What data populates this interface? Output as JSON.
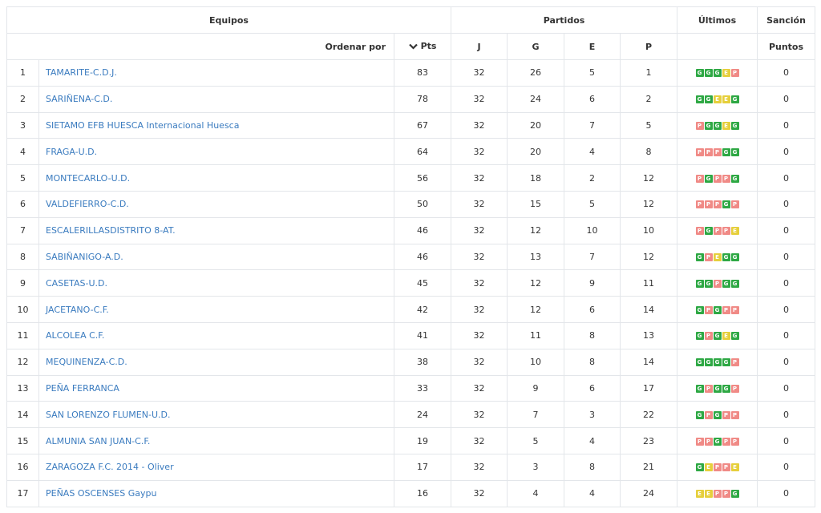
{
  "colors": {
    "win": "#2ea844",
    "draw": "#e6cf3c",
    "loss": "#f08a86",
    "link": "#3a7bbf"
  },
  "header": {
    "equipos": "Equipos",
    "partidos": "Partidos",
    "ultimos": "Últimos",
    "sancion": "Sanción",
    "ordenar_por": "Ordenar por",
    "sort_icon": "chevron-down-icon",
    "pts": "Pts",
    "j": "J",
    "g": "G",
    "e": "E",
    "p": "P",
    "puntos": "Puntos"
  },
  "rows": [
    {
      "pos": "1",
      "team": "TAMARITE-C.D.J.",
      "pts": "83",
      "j": "32",
      "g": "26",
      "e": "5",
      "p": "1",
      "form": [
        "G",
        "G",
        "G",
        "E",
        "P"
      ],
      "sancion": "0"
    },
    {
      "pos": "2",
      "team": "SARIÑENA-C.D.",
      "pts": "78",
      "j": "32",
      "g": "24",
      "e": "6",
      "p": "2",
      "form": [
        "G",
        "G",
        "E",
        "E",
        "G"
      ],
      "sancion": "0"
    },
    {
      "pos": "3",
      "team": "SIETAMO EFB HUESCA Internacional Huesca",
      "pts": "67",
      "j": "32",
      "g": "20",
      "e": "7",
      "p": "5",
      "form": [
        "P",
        "G",
        "G",
        "E",
        "G"
      ],
      "sancion": "0"
    },
    {
      "pos": "4",
      "team": "FRAGA-U.D.",
      "pts": "64",
      "j": "32",
      "g": "20",
      "e": "4",
      "p": "8",
      "form": [
        "P",
        "P",
        "P",
        "G",
        "G"
      ],
      "sancion": "0"
    },
    {
      "pos": "5",
      "team": "MONTECARLO-U.D.",
      "pts": "56",
      "j": "32",
      "g": "18",
      "e": "2",
      "p": "12",
      "form": [
        "P",
        "G",
        "P",
        "P",
        "G"
      ],
      "sancion": "0"
    },
    {
      "pos": "6",
      "team": "VALDEFIERRO-C.D.",
      "pts": "50",
      "j": "32",
      "g": "15",
      "e": "5",
      "p": "12",
      "form": [
        "P",
        "P",
        "P",
        "G",
        "P"
      ],
      "sancion": "0"
    },
    {
      "pos": "7",
      "team": "ESCALERILLASDISTRITO 8-AT.",
      "pts": "46",
      "j": "32",
      "g": "12",
      "e": "10",
      "p": "10",
      "form": [
        "P",
        "G",
        "P",
        "P",
        "E"
      ],
      "sancion": "0"
    },
    {
      "pos": "8",
      "team": "SABIÑANIGO-A.D.",
      "pts": "46",
      "j": "32",
      "g": "13",
      "e": "7",
      "p": "12",
      "form": [
        "G",
        "P",
        "E",
        "G",
        "G"
      ],
      "sancion": "0"
    },
    {
      "pos": "9",
      "team": "CASETAS-U.D.",
      "pts": "45",
      "j": "32",
      "g": "12",
      "e": "9",
      "p": "11",
      "form": [
        "G",
        "G",
        "P",
        "G",
        "G"
      ],
      "sancion": "0"
    },
    {
      "pos": "10",
      "team": "JACETANO-C.F.",
      "pts": "42",
      "j": "32",
      "g": "12",
      "e": "6",
      "p": "14",
      "form": [
        "G",
        "P",
        "G",
        "P",
        "P"
      ],
      "sancion": "0"
    },
    {
      "pos": "11",
      "team": "ALCOLEA C.F.",
      "pts": "41",
      "j": "32",
      "g": "11",
      "e": "8",
      "p": "13",
      "form": [
        "G",
        "P",
        "G",
        "E",
        "G"
      ],
      "sancion": "0"
    },
    {
      "pos": "12",
      "team": "MEQUINENZA-C.D.",
      "pts": "38",
      "j": "32",
      "g": "10",
      "e": "8",
      "p": "14",
      "form": [
        "G",
        "G",
        "G",
        "G",
        "P"
      ],
      "sancion": "0"
    },
    {
      "pos": "13",
      "team": "PEÑA FERRANCA",
      "pts": "33",
      "j": "32",
      "g": "9",
      "e": "6",
      "p": "17",
      "form": [
        "G",
        "P",
        "G",
        "G",
        "P"
      ],
      "sancion": "0"
    },
    {
      "pos": "14",
      "team": "SAN LORENZO FLUMEN-U.D.",
      "pts": "24",
      "j": "32",
      "g": "7",
      "e": "3",
      "p": "22",
      "form": [
        "G",
        "P",
        "G",
        "P",
        "P"
      ],
      "sancion": "0"
    },
    {
      "pos": "15",
      "team": "ALMUNIA SAN JUAN-C.F.",
      "pts": "19",
      "j": "32",
      "g": "5",
      "e": "4",
      "p": "23",
      "form": [
        "P",
        "P",
        "G",
        "P",
        "P"
      ],
      "sancion": "0"
    },
    {
      "pos": "16",
      "team": "ZARAGOZA F.C. 2014 - Oliver",
      "pts": "17",
      "j": "32",
      "g": "3",
      "e": "8",
      "p": "21",
      "form": [
        "G",
        "E",
        "P",
        "P",
        "E"
      ],
      "sancion": "0"
    },
    {
      "pos": "17",
      "team": "PEÑAS OSCENSES Gaypu",
      "pts": "16",
      "j": "32",
      "g": "4",
      "e": "4",
      "p": "24",
      "form": [
        "E",
        "E",
        "P",
        "P",
        "G"
      ],
      "sancion": "0"
    }
  ]
}
